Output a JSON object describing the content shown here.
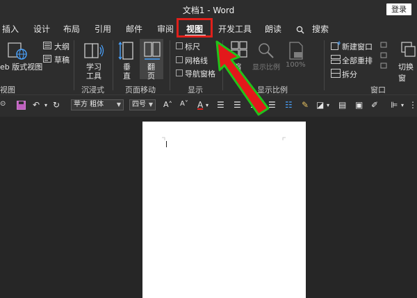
{
  "window": {
    "title": "文档1  -  Word",
    "login_label": "登录"
  },
  "tabs": {
    "insert": "插入",
    "design": "设计",
    "layout": "布局",
    "references": "引用",
    "mailings": "邮件",
    "review": "审阅",
    "view": "视图",
    "developer": "开发工具",
    "read_aloud": "朗读",
    "search": "搜索"
  },
  "ribbon": {
    "views": {
      "web_view": "eb 版式视图",
      "outline": "大纲",
      "draft": "草稿",
      "group": "视图"
    },
    "immersive": {
      "learning_tools_1": "学习",
      "learning_tools_2": "工具",
      "group": "沉浸式"
    },
    "page_movement": {
      "vertical_1": "垂",
      "vertical_2": "直",
      "side_1": "翻",
      "side_2": "页",
      "group": "页面移动"
    },
    "show": {
      "ruler": "标尺",
      "gridlines": "网格线",
      "nav_pane": "导航窗格",
      "group": "显示"
    },
    "zoom": {
      "zoom_label": "缩",
      "zoom_label_2": "放",
      "zoom_to": "显示比例",
      "hundred": "100%",
      "group": "显示比例"
    },
    "window": {
      "new_window": "新建窗口",
      "arrange_all": "全部重排",
      "split": "拆分",
      "switch_windows": "切换窗",
      "group": "窗口"
    }
  },
  "format_bar": {
    "font_name": "苹方 粗体",
    "font_size": "四号"
  },
  "colors": {
    "accent_red": "#e0201b",
    "arrow_green": "#21c21b",
    "arrow_red": "#e3181b"
  }
}
